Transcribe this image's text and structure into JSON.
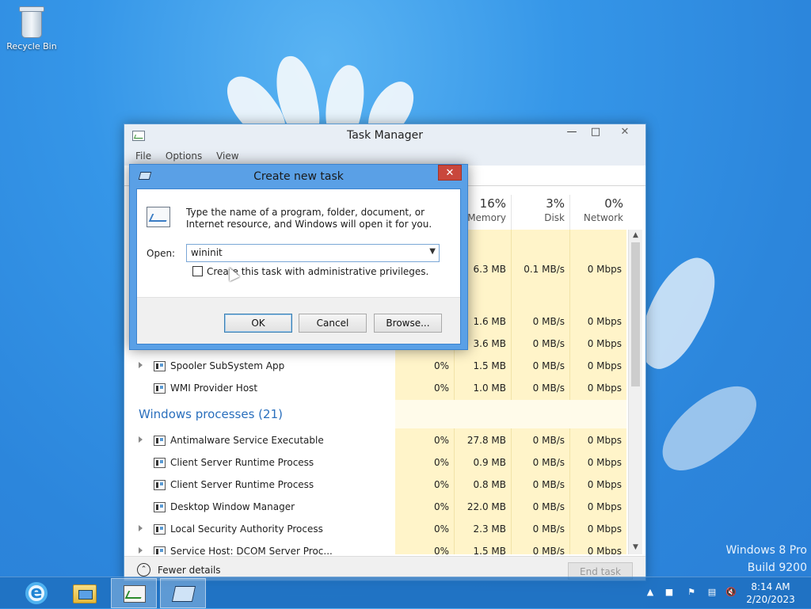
{
  "desktop": {
    "recycle_bin_label": "Recycle Bin",
    "watermark_line1": "Windows 8 Pro",
    "watermark_line2": "Build 9200"
  },
  "task_manager": {
    "title": "Task Manager",
    "menu": [
      "File",
      "Options",
      "View"
    ],
    "columns": [
      {
        "pct": "16%",
        "name": "Memory"
      },
      {
        "pct": "3%",
        "name": "Disk"
      },
      {
        "pct": "0%",
        "name": "Network"
      }
    ],
    "rows_top": [
      {
        "cpu": "",
        "mem": "6.3 MB",
        "disk": "0.1 MB/s",
        "net": "0 Mbps"
      },
      {
        "cpu": "",
        "mem": "1.6 MB",
        "disk": "0 MB/s",
        "net": "0 Mbps"
      },
      {
        "cpu": "",
        "mem": "3.6 MB",
        "disk": "0 MB/s",
        "net": "0 Mbps"
      }
    ],
    "rows_bg": [
      {
        "name": "Spooler SubSystem App",
        "cpu": "0%",
        "mem": "1.5 MB",
        "disk": "0 MB/s",
        "net": "0 Mbps"
      },
      {
        "name": "WMI Provider Host",
        "cpu": "0%",
        "mem": "1.0 MB",
        "disk": "0 MB/s",
        "net": "0 Mbps"
      }
    ],
    "group_windows": "Windows processes (21)",
    "rows_win": [
      {
        "name": "Antimalware Service Executable",
        "cpu": "0%",
        "mem": "27.8 MB",
        "disk": "0 MB/s",
        "net": "0 Mbps"
      },
      {
        "name": "Client Server Runtime Process",
        "cpu": "0%",
        "mem": "0.9 MB",
        "disk": "0 MB/s",
        "net": "0 Mbps"
      },
      {
        "name": "Client Server Runtime Process",
        "cpu": "0%",
        "mem": "0.8 MB",
        "disk": "0 MB/s",
        "net": "0 Mbps"
      },
      {
        "name": "Desktop Window Manager",
        "cpu": "0%",
        "mem": "22.0 MB",
        "disk": "0 MB/s",
        "net": "0 Mbps"
      },
      {
        "name": "Local Security Authority Process",
        "cpu": "0%",
        "mem": "2.3 MB",
        "disk": "0 MB/s",
        "net": "0 Mbps"
      },
      {
        "name": "Service Host: DCOM Server Proc...",
        "cpu": "0%",
        "mem": "1.5 MB",
        "disk": "0 MB/s",
        "net": "0 Mbps"
      }
    ],
    "fewer_details": "Fewer details",
    "end_task": "End task"
  },
  "dialog": {
    "title": "Create new task",
    "message": "Type the name of a program, folder, document, or Internet resource, and Windows will open it for you.",
    "open_label": "Open:",
    "open_value": "wininit",
    "checkbox_label": "Create this task with administrative privileges.",
    "ok": "OK",
    "cancel": "Cancel",
    "browse": "Browse..."
  },
  "taskbar": {
    "clock_time": "8:14 AM",
    "clock_date": "2/20/2023"
  }
}
